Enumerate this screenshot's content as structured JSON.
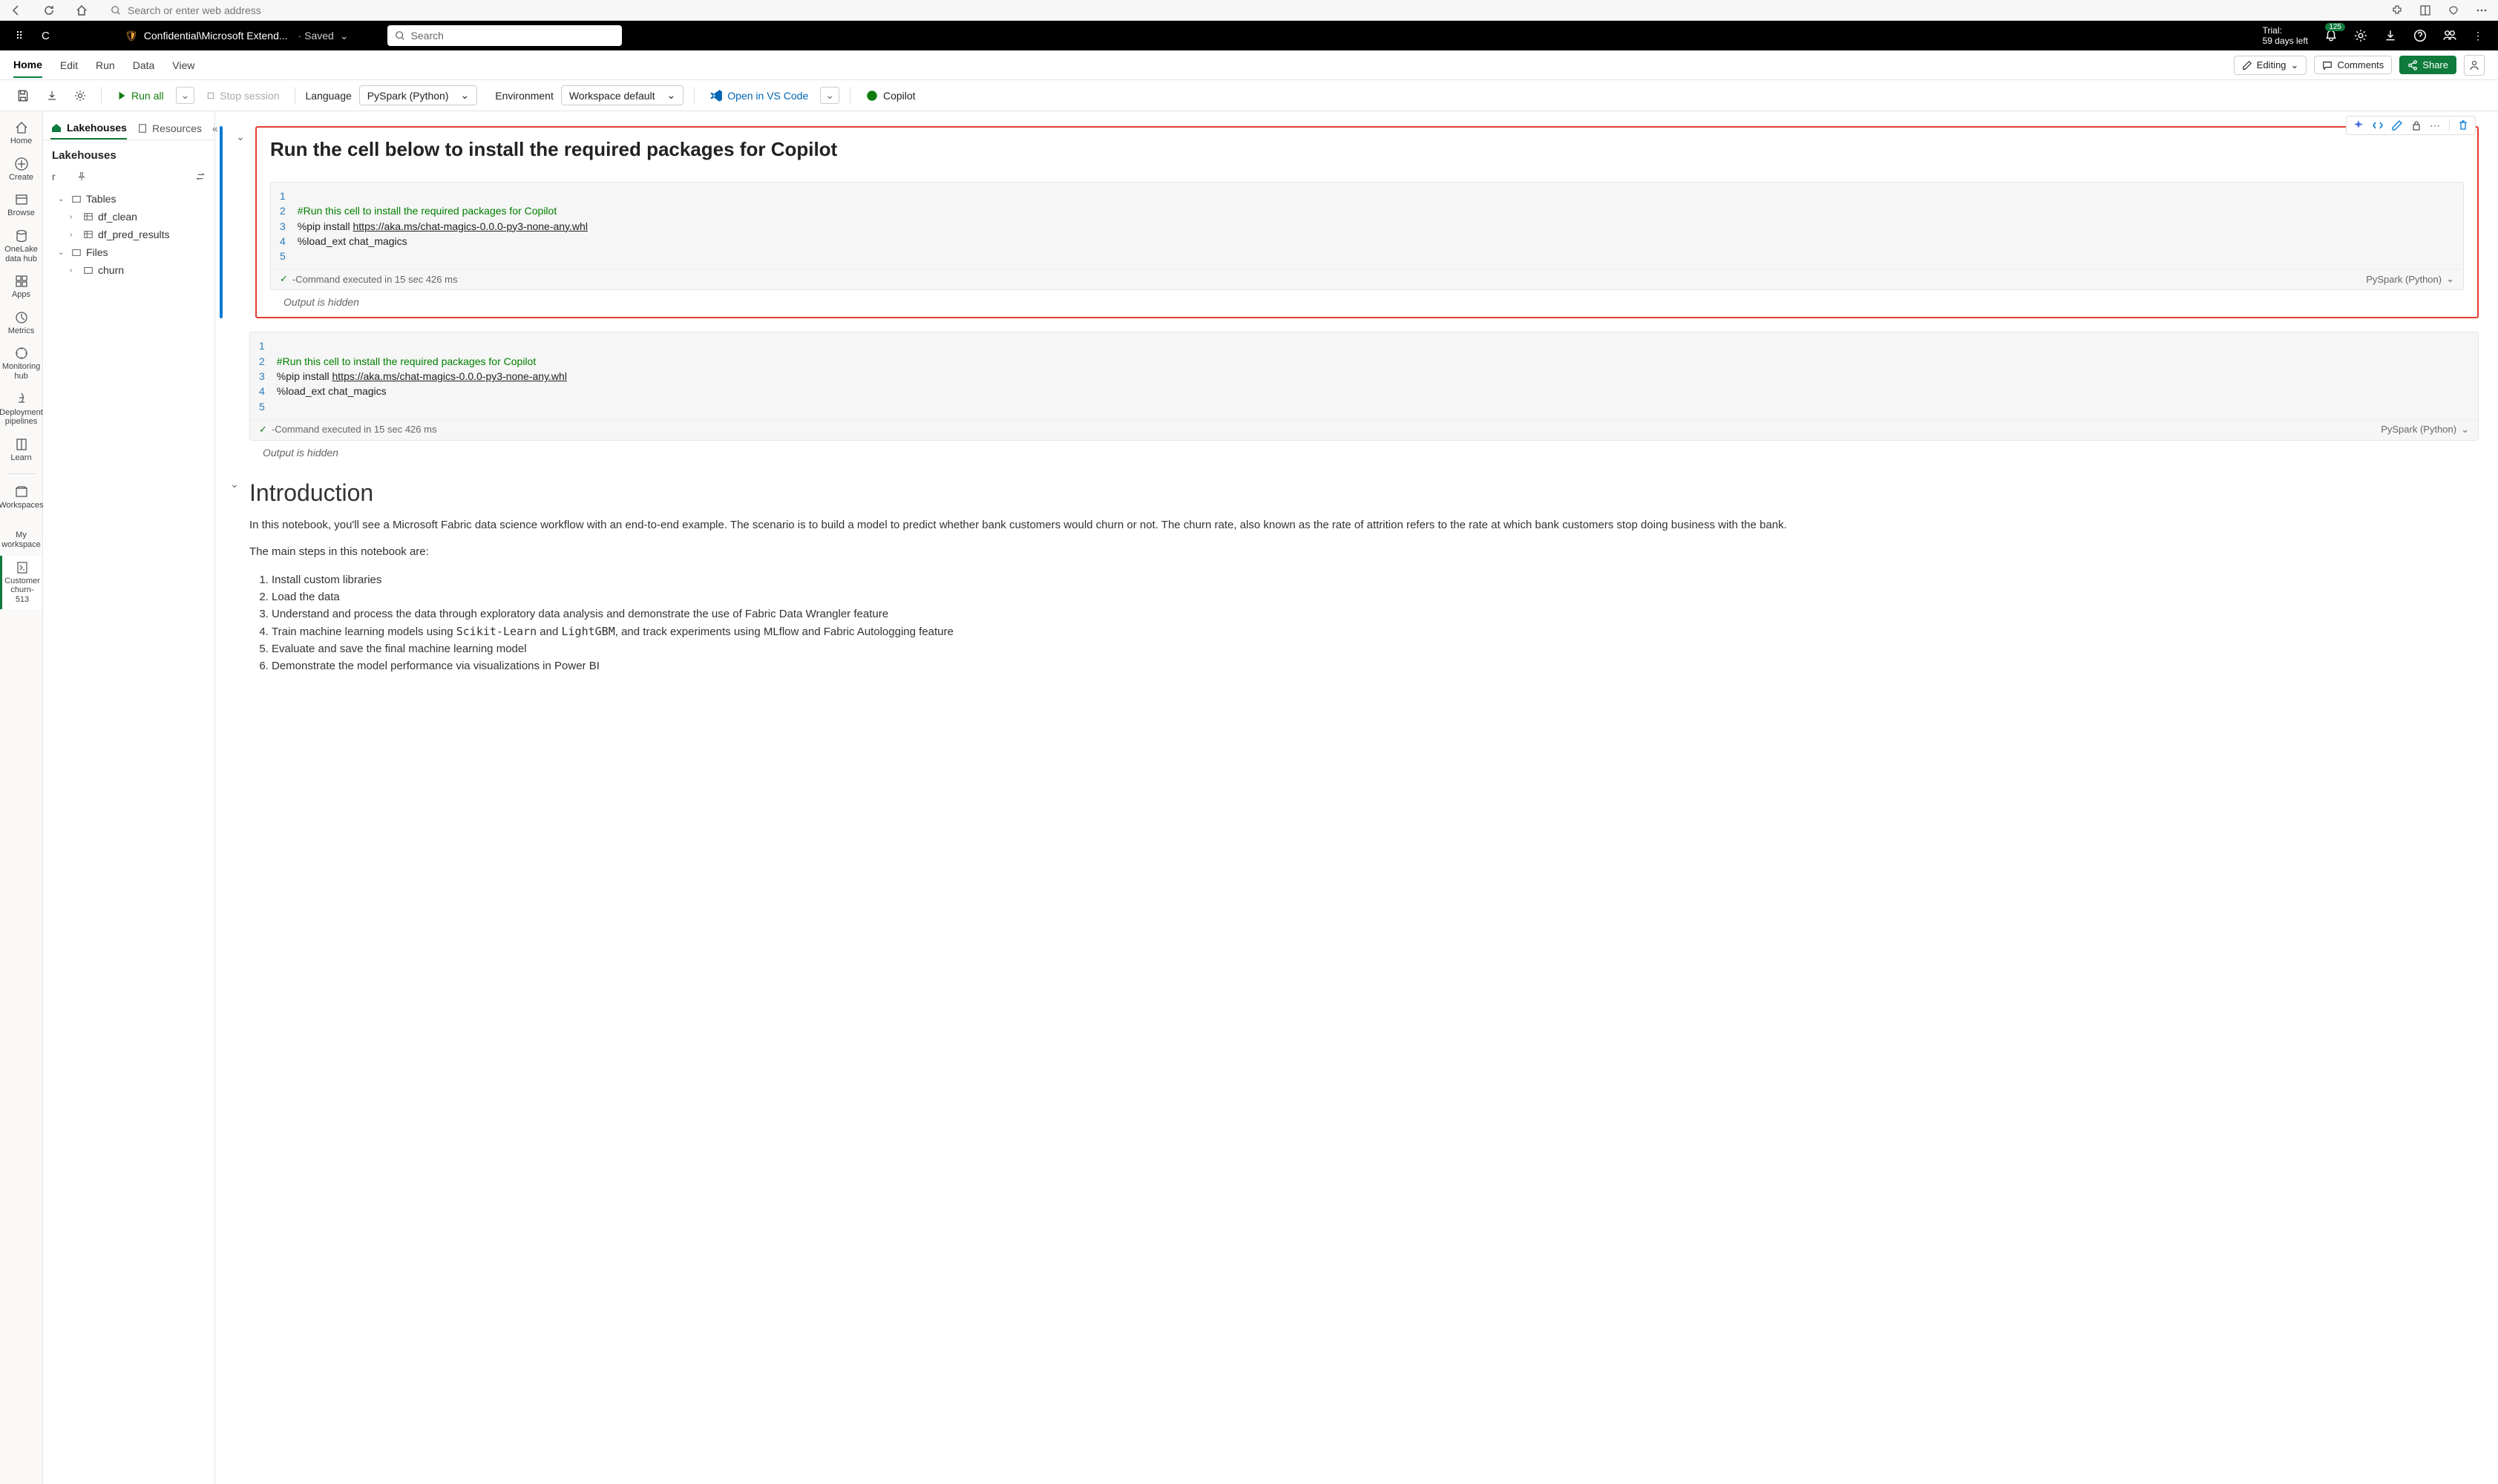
{
  "browser": {
    "placeholder": "Search or enter web address"
  },
  "appbar": {
    "c": "C",
    "crumb": "Confidential\\Microsoft Extend...",
    "saved": "Saved",
    "search_placeholder": "Search",
    "trial_label": "Trial:",
    "trial_days": "59 days left",
    "badge": "125"
  },
  "tabs": {
    "home": "Home",
    "edit": "Edit",
    "run": "Run",
    "data": "Data",
    "view": "View",
    "editing": "Editing",
    "comments": "Comments",
    "share": "Share"
  },
  "toolbar": {
    "runall": "Run all",
    "stop": "Stop session",
    "language_label": "Language",
    "language_value": "PySpark (Python)",
    "env_label": "Environment",
    "env_value": "Workspace default",
    "vscode": "Open in VS Code",
    "copilot": "Copilot"
  },
  "rail": {
    "home": "Home",
    "create": "Create",
    "browse": "Browse",
    "onelake": "OneLake data hub",
    "apps": "Apps",
    "metrics": "Metrics",
    "monitoring": "Monitoring hub",
    "deploy": "Deployment pipelines",
    "learn": "Learn",
    "workspaces": "Workspaces",
    "myws": "My workspace",
    "item": "Customer churn-513"
  },
  "sidepanel": {
    "tab_lakehouses": "Lakehouses",
    "tab_resources": "Resources",
    "title": "Lakehouses",
    "row_letter": "r",
    "tables": "Tables",
    "df_clean": "df_clean",
    "df_pred": "df_pred_results",
    "files": "Files",
    "churn": "churn"
  },
  "cell1": {
    "title": "Run the cell below to install the required packages for Copilot",
    "comment": "#Run this cell to install the required packages for Copilot",
    "pip_prefix": "%pip install ",
    "pip_url": "https://aka.ms/chat-magics-0.0.0-py3-none-any.whl",
    "load": "%load_ext chat_magics",
    "status": "-Command executed in 15 sec 426 ms",
    "lang": "PySpark (Python)",
    "output": "Output is hidden"
  },
  "cell2": {
    "comment": "#Run this cell to install the required packages for Copilot",
    "pip_prefix": "%pip install ",
    "pip_url": "https://aka.ms/chat-magics-0.0.0-py3-none-any.whl",
    "load": "%load_ext chat_magics",
    "status": "-Command executed in 15 sec 426 ms",
    "lang": "PySpark (Python)",
    "output": "Output is hidden"
  },
  "intro": {
    "heading": "Introduction",
    "p1": "In this notebook, you'll see a Microsoft Fabric data science workflow with an end-to-end example. The scenario is to build a model to predict whether bank customers would churn or not. The churn rate, also known as the rate of attrition refers to the rate at which bank customers stop doing business with the bank.",
    "p2": "The main steps in this notebook are:",
    "s1": "Install custom libraries",
    "s2": "Load the data",
    "s3": "Understand and process the data through exploratory data analysis and demonstrate the use of Fabric Data Wrangler feature",
    "s4a": "Train machine learning models using ",
    "s4b": "Scikit-Learn",
    "s4c": " and ",
    "s4d": "LightGBM",
    "s4e": ", and track experiments using MLflow and Fabric Autologging feature",
    "s5": "Evaluate and save the final machine learning model",
    "s6": "Demonstrate the model performance via visualizations in Power BI"
  }
}
